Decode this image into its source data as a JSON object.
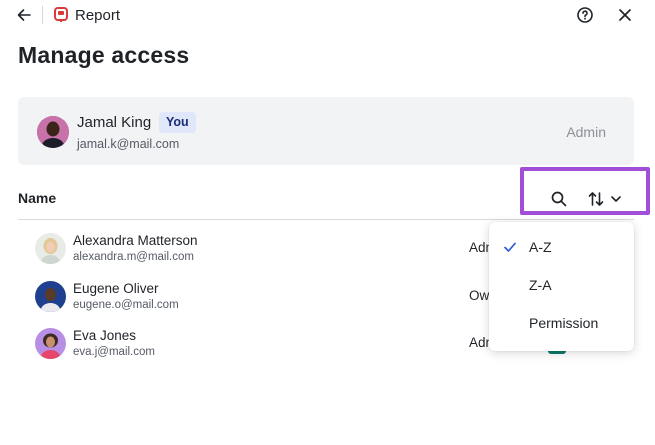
{
  "header": {
    "back_icon": "arrow-left-icon",
    "app_icon": "report-icon",
    "app_title": "Report",
    "help_icon": "help-circle-icon",
    "close_icon": "close-icon"
  },
  "page_title": "Manage access",
  "current_user": {
    "name": "Jamal King",
    "badge": "You",
    "email": "jamal.k@mail.com",
    "role": "Admin"
  },
  "list": {
    "column_header": "Name",
    "search_icon": "search-icon",
    "sort_icon": "sort-arrows-icon",
    "members": [
      {
        "name": "Alexandra Matterson",
        "email": "alexandra.m@mail.com",
        "role": "Adm"
      },
      {
        "name": "Eugene Oliver",
        "email": "eugene.o@mail.com",
        "role": "Ow"
      },
      {
        "name": "Eva Jones",
        "email": "eva.j@mail.com",
        "role": "Adm"
      }
    ]
  },
  "sort_menu": {
    "options": [
      {
        "label": "A-Z",
        "selected": true
      },
      {
        "label": "Z-A",
        "selected": false
      },
      {
        "label": "Permission",
        "selected": false
      }
    ]
  },
  "colors": {
    "accent": "#2f5bd3",
    "focus_outline": "#a14fd9",
    "badge_bg": "#e0e7fb",
    "card_bg": "#f2f3f5"
  }
}
